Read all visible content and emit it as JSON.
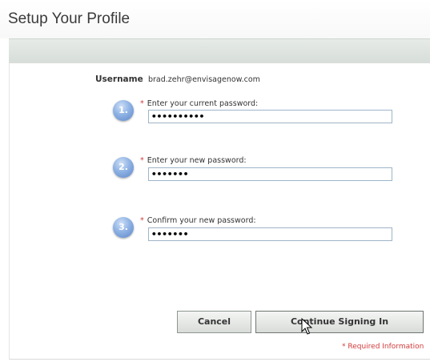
{
  "header": {
    "title": "Setup Your Profile"
  },
  "user": {
    "label": "Username",
    "value": "brad.zehr@envisagenow.com"
  },
  "steps": [
    {
      "number": "1.",
      "star": "*",
      "label": "Enter your current password:",
      "masked_value": "••••••••••"
    },
    {
      "number": "2.",
      "star": "*",
      "label": "Enter your new password:",
      "masked_value": "•••••••"
    },
    {
      "number": "3.",
      "star": "*",
      "label": "Confirm your new password:",
      "masked_value": "•••••••"
    }
  ],
  "actions": {
    "cancel_label": "Cancel",
    "continue_label": "Continue Signing In"
  },
  "footer": {
    "required_info": "* Required Information"
  },
  "colors": {
    "required": "#d23a3a",
    "step_badge": "#6f97d6",
    "band": "#dde2df"
  }
}
